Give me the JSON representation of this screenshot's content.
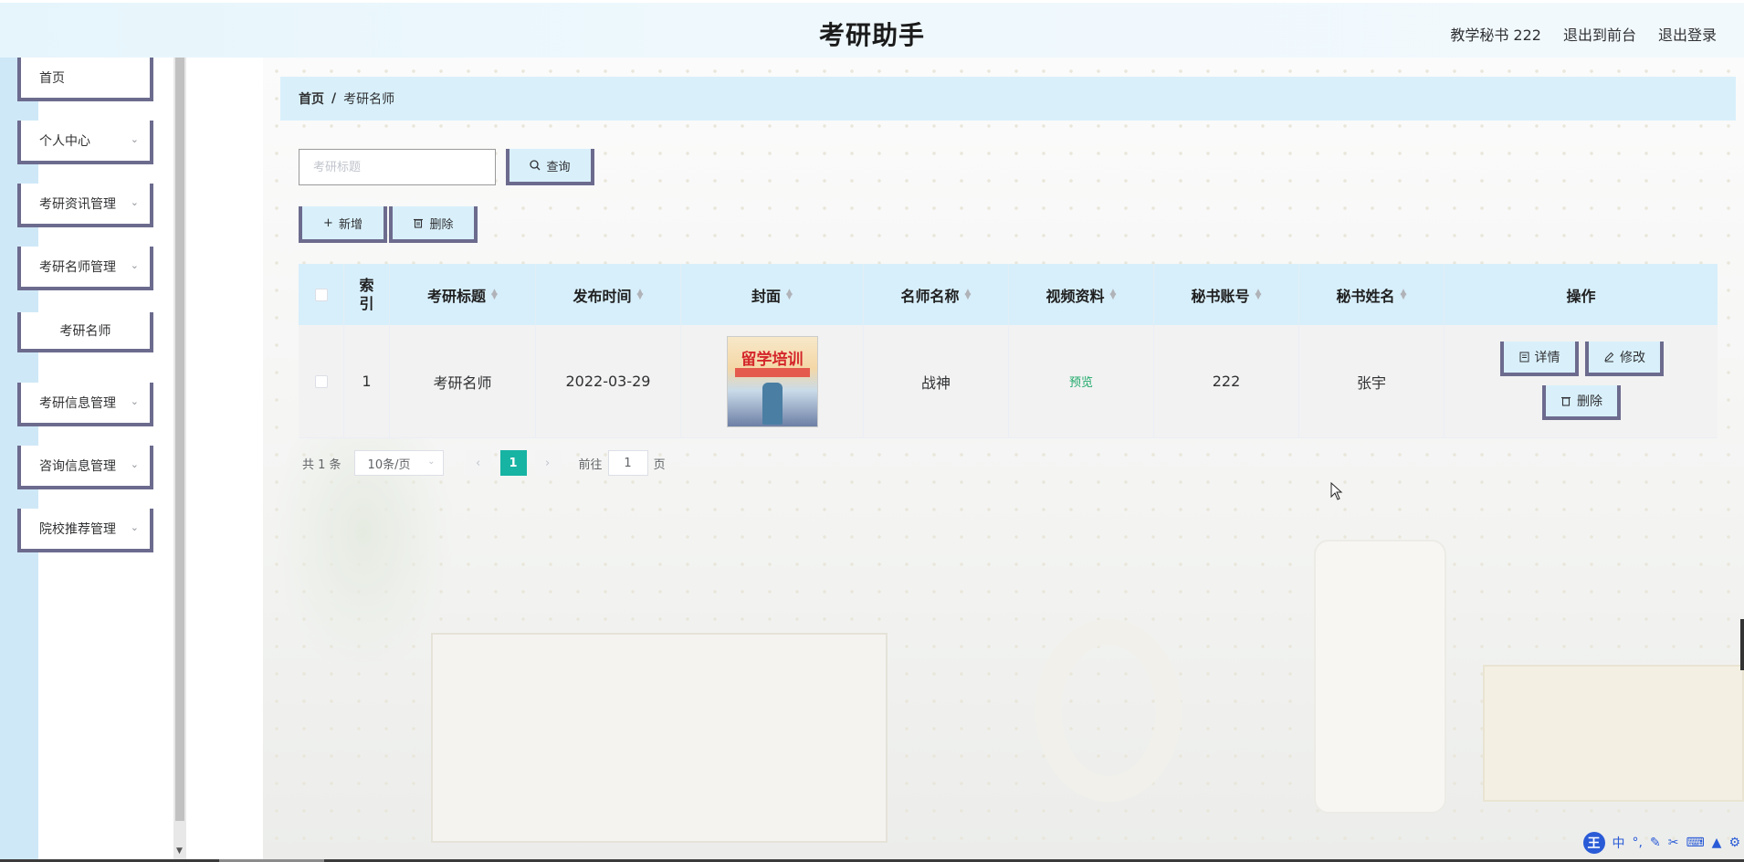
{
  "header": {
    "app_title": "考研助手",
    "user_label": "教学秘书 222",
    "front_label": "退出到前台",
    "logout_label": "退出登录"
  },
  "sidebar": {
    "items": [
      {
        "label": "首页",
        "has_children": false
      },
      {
        "label": "个人中心",
        "has_children": true
      },
      {
        "label": "考研资讯管理",
        "has_children": true
      },
      {
        "label": "考研名师管理",
        "has_children": true
      },
      {
        "label": "考研名师",
        "has_children": false,
        "submenu": true
      },
      {
        "label": "考研信息管理",
        "has_children": true
      },
      {
        "label": "咨询信息管理",
        "has_children": true
      },
      {
        "label": "院校推荐管理",
        "has_children": true
      }
    ]
  },
  "breadcrumb": {
    "home": "首页",
    "separator": "/",
    "current": "考研名师"
  },
  "search": {
    "placeholder": "考研标题",
    "value": "",
    "button_label": "查询"
  },
  "actions": {
    "add_label": "新增",
    "delete_label": "删除"
  },
  "table": {
    "columns": [
      "索引",
      "考研标题",
      "发布时间",
      "封面",
      "名师名称",
      "视频资料",
      "秘书账号",
      "秘书姓名",
      "操作"
    ],
    "rows": [
      {
        "index": "1",
        "title": "考研名师",
        "publish_date": "2022-03-29",
        "cover_text": "留学培训",
        "teacher_name": "战神",
        "video": "预览",
        "secretary_account": "222",
        "secretary_name": "张宇",
        "op_detail": "详情",
        "op_edit": "修改",
        "op_delete": "删除"
      }
    ]
  },
  "pagination": {
    "total_text": "共 1 条",
    "page_size": "10条/页",
    "current_page": "1",
    "goto_prefix": "前往",
    "goto_value": "1",
    "goto_suffix": "页"
  },
  "ime": {
    "logo": "王",
    "mode": "中"
  },
  "colors": {
    "accent_bg": "#d9f0fb",
    "button_border": "#6c6b8e",
    "pager_active": "#17b3a3",
    "preview_link": "#1fa96a"
  }
}
